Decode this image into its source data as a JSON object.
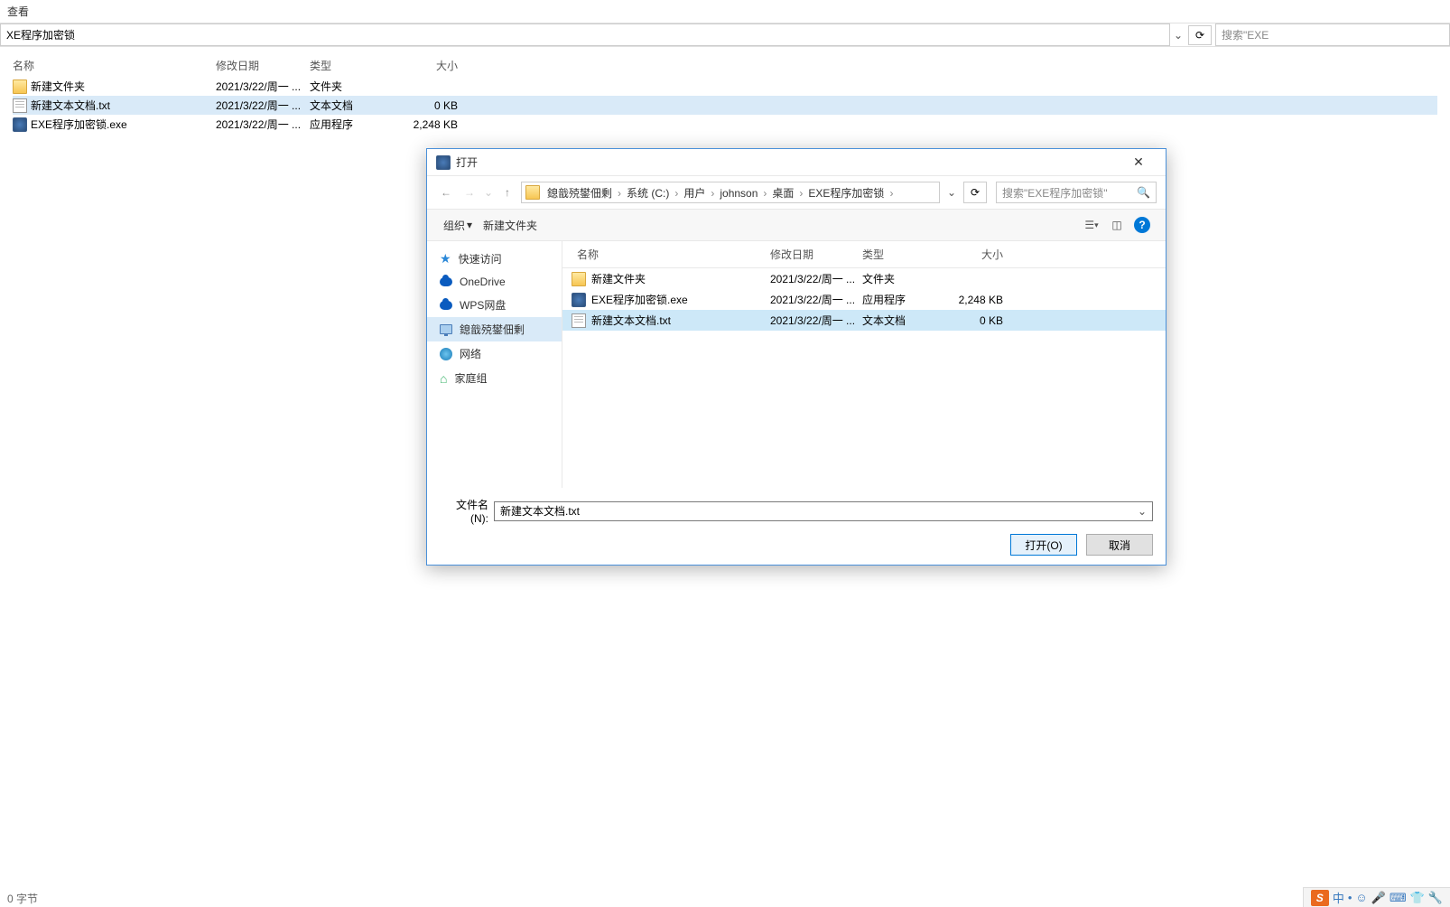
{
  "main": {
    "tab": "查看",
    "path": "XE程序加密锁",
    "search_placeholder": "搜索\"EXE",
    "headers": {
      "name": "名称",
      "date": "修改日期",
      "type": "类型",
      "size": "大小"
    },
    "rows": [
      {
        "icon": "folder",
        "name": "新建文件夹",
        "date": "2021/3/22/周一 ...",
        "type": "文件夹",
        "size": "",
        "selected": false
      },
      {
        "icon": "file",
        "name": "新建文本文档.txt",
        "date": "2021/3/22/周一 ...",
        "type": "文本文档",
        "size": "0 KB",
        "selected": true
      },
      {
        "icon": "exe",
        "name": "EXE程序加密锁.exe",
        "date": "2021/3/22/周一 ...",
        "type": "应用程序",
        "size": "2,248 KB",
        "selected": false
      }
    ]
  },
  "dialog": {
    "title": "打开",
    "breadcrumbs": [
      "鎴戠殑鐢佃剰",
      "系统 (C:)",
      "用户",
      "johnson",
      "桌面",
      "EXE程序加密锁"
    ],
    "search_placeholder": "搜索\"EXE程序加密锁\"",
    "toolbar": {
      "organize": "组织",
      "new_folder": "新建文件夹"
    },
    "sidebar": [
      {
        "icon": "star",
        "label": "快速访问",
        "selected": false
      },
      {
        "icon": "cloud",
        "label": "OneDrive",
        "selected": false
      },
      {
        "icon": "cloud",
        "label": "WPS网盘",
        "selected": false
      },
      {
        "icon": "monitor",
        "label": "鎴戠殑鐢佃剰",
        "selected": true
      },
      {
        "icon": "globe",
        "label": "网络",
        "selected": false
      },
      {
        "icon": "home",
        "label": "家庭组",
        "selected": false
      }
    ],
    "list": {
      "headers": {
        "name": "名称",
        "date": "修改日期",
        "type": "类型",
        "size": "大小"
      },
      "rows": [
        {
          "icon": "folder",
          "name": "新建文件夹",
          "date": "2021/3/22/周一 ...",
          "type": "文件夹",
          "size": "",
          "selected": false
        },
        {
          "icon": "exe",
          "name": "EXE程序加密锁.exe",
          "date": "2021/3/22/周一 ...",
          "type": "应用程序",
          "size": "2,248 KB",
          "selected": false
        },
        {
          "icon": "file",
          "name": "新建文本文档.txt",
          "date": "2021/3/22/周一 ...",
          "type": "文本文档",
          "size": "0 KB",
          "selected": true
        }
      ]
    },
    "filename_label": "文件名(N):",
    "filename_value": "新建文本文档.txt",
    "open_button": "打开(O)",
    "cancel_button": "取消"
  },
  "status": {
    "text": "0 字节"
  },
  "ime": {
    "logo": "S"
  }
}
